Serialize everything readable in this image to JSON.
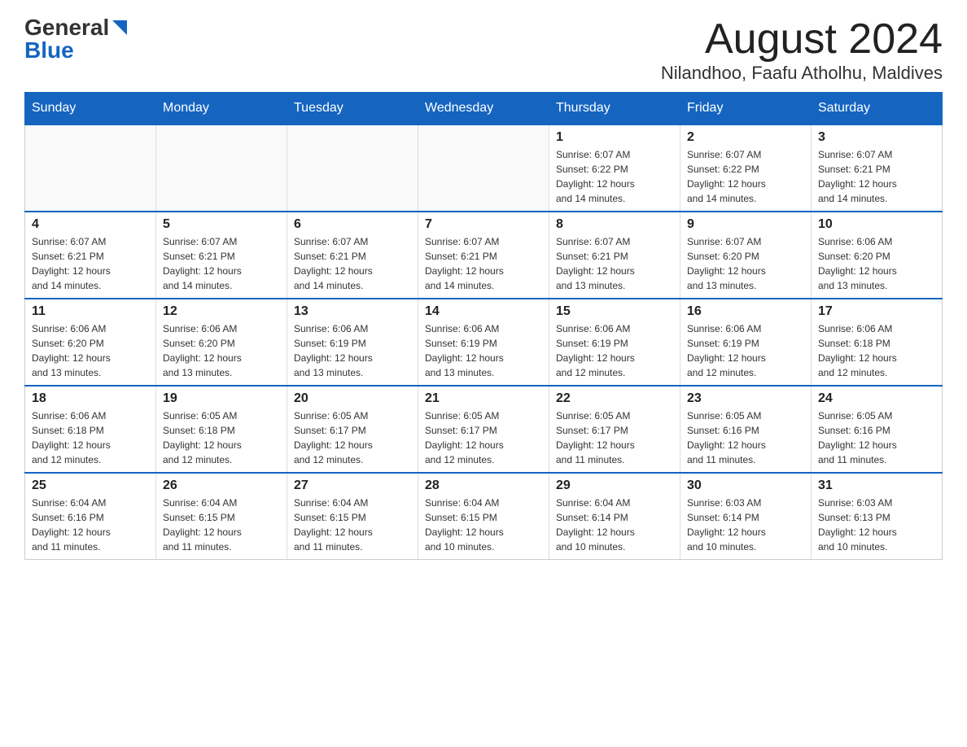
{
  "header": {
    "logo_general": "General",
    "logo_blue": "Blue",
    "month": "August 2024",
    "location": "Nilandhoo, Faafu Atholhu, Maldives"
  },
  "days_of_week": [
    "Sunday",
    "Monday",
    "Tuesday",
    "Wednesday",
    "Thursday",
    "Friday",
    "Saturday"
  ],
  "weeks": [
    {
      "days": [
        {
          "number": "",
          "info": ""
        },
        {
          "number": "",
          "info": ""
        },
        {
          "number": "",
          "info": ""
        },
        {
          "number": "",
          "info": ""
        },
        {
          "number": "1",
          "info": "Sunrise: 6:07 AM\nSunset: 6:22 PM\nDaylight: 12 hours\nand 14 minutes."
        },
        {
          "number": "2",
          "info": "Sunrise: 6:07 AM\nSunset: 6:22 PM\nDaylight: 12 hours\nand 14 minutes."
        },
        {
          "number": "3",
          "info": "Sunrise: 6:07 AM\nSunset: 6:21 PM\nDaylight: 12 hours\nand 14 minutes."
        }
      ]
    },
    {
      "days": [
        {
          "number": "4",
          "info": "Sunrise: 6:07 AM\nSunset: 6:21 PM\nDaylight: 12 hours\nand 14 minutes."
        },
        {
          "number": "5",
          "info": "Sunrise: 6:07 AM\nSunset: 6:21 PM\nDaylight: 12 hours\nand 14 minutes."
        },
        {
          "number": "6",
          "info": "Sunrise: 6:07 AM\nSunset: 6:21 PM\nDaylight: 12 hours\nand 14 minutes."
        },
        {
          "number": "7",
          "info": "Sunrise: 6:07 AM\nSunset: 6:21 PM\nDaylight: 12 hours\nand 14 minutes."
        },
        {
          "number": "8",
          "info": "Sunrise: 6:07 AM\nSunset: 6:21 PM\nDaylight: 12 hours\nand 13 minutes."
        },
        {
          "number": "9",
          "info": "Sunrise: 6:07 AM\nSunset: 6:20 PM\nDaylight: 12 hours\nand 13 minutes."
        },
        {
          "number": "10",
          "info": "Sunrise: 6:06 AM\nSunset: 6:20 PM\nDaylight: 12 hours\nand 13 minutes."
        }
      ]
    },
    {
      "days": [
        {
          "number": "11",
          "info": "Sunrise: 6:06 AM\nSunset: 6:20 PM\nDaylight: 12 hours\nand 13 minutes."
        },
        {
          "number": "12",
          "info": "Sunrise: 6:06 AM\nSunset: 6:20 PM\nDaylight: 12 hours\nand 13 minutes."
        },
        {
          "number": "13",
          "info": "Sunrise: 6:06 AM\nSunset: 6:19 PM\nDaylight: 12 hours\nand 13 minutes."
        },
        {
          "number": "14",
          "info": "Sunrise: 6:06 AM\nSunset: 6:19 PM\nDaylight: 12 hours\nand 13 minutes."
        },
        {
          "number": "15",
          "info": "Sunrise: 6:06 AM\nSunset: 6:19 PM\nDaylight: 12 hours\nand 12 minutes."
        },
        {
          "number": "16",
          "info": "Sunrise: 6:06 AM\nSunset: 6:19 PM\nDaylight: 12 hours\nand 12 minutes."
        },
        {
          "number": "17",
          "info": "Sunrise: 6:06 AM\nSunset: 6:18 PM\nDaylight: 12 hours\nand 12 minutes."
        }
      ]
    },
    {
      "days": [
        {
          "number": "18",
          "info": "Sunrise: 6:06 AM\nSunset: 6:18 PM\nDaylight: 12 hours\nand 12 minutes."
        },
        {
          "number": "19",
          "info": "Sunrise: 6:05 AM\nSunset: 6:18 PM\nDaylight: 12 hours\nand 12 minutes."
        },
        {
          "number": "20",
          "info": "Sunrise: 6:05 AM\nSunset: 6:17 PM\nDaylight: 12 hours\nand 12 minutes."
        },
        {
          "number": "21",
          "info": "Sunrise: 6:05 AM\nSunset: 6:17 PM\nDaylight: 12 hours\nand 12 minutes."
        },
        {
          "number": "22",
          "info": "Sunrise: 6:05 AM\nSunset: 6:17 PM\nDaylight: 12 hours\nand 11 minutes."
        },
        {
          "number": "23",
          "info": "Sunrise: 6:05 AM\nSunset: 6:16 PM\nDaylight: 12 hours\nand 11 minutes."
        },
        {
          "number": "24",
          "info": "Sunrise: 6:05 AM\nSunset: 6:16 PM\nDaylight: 12 hours\nand 11 minutes."
        }
      ]
    },
    {
      "days": [
        {
          "number": "25",
          "info": "Sunrise: 6:04 AM\nSunset: 6:16 PM\nDaylight: 12 hours\nand 11 minutes."
        },
        {
          "number": "26",
          "info": "Sunrise: 6:04 AM\nSunset: 6:15 PM\nDaylight: 12 hours\nand 11 minutes."
        },
        {
          "number": "27",
          "info": "Sunrise: 6:04 AM\nSunset: 6:15 PM\nDaylight: 12 hours\nand 11 minutes."
        },
        {
          "number": "28",
          "info": "Sunrise: 6:04 AM\nSunset: 6:15 PM\nDaylight: 12 hours\nand 10 minutes."
        },
        {
          "number": "29",
          "info": "Sunrise: 6:04 AM\nSunset: 6:14 PM\nDaylight: 12 hours\nand 10 minutes."
        },
        {
          "number": "30",
          "info": "Sunrise: 6:03 AM\nSunset: 6:14 PM\nDaylight: 12 hours\nand 10 minutes."
        },
        {
          "number": "31",
          "info": "Sunrise: 6:03 AM\nSunset: 6:13 PM\nDaylight: 12 hours\nand 10 minutes."
        }
      ]
    }
  ]
}
